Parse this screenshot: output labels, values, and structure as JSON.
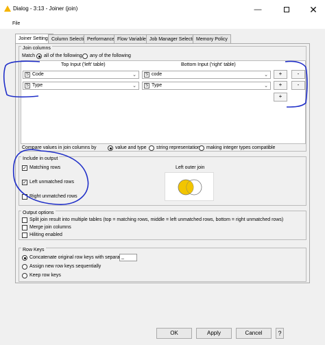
{
  "window": {
    "title": "Dialog - 3:13 - Joiner (join)",
    "minimize": "—",
    "close": "✕"
  },
  "menu": {
    "file": "File"
  },
  "tabs": [
    {
      "label": "Joiner Settings"
    },
    {
      "label": "Column Selection"
    },
    {
      "label": "Performance"
    },
    {
      "label": "Flow Variables"
    },
    {
      "label": "Job Manager Selection"
    },
    {
      "label": "Memory Policy"
    }
  ],
  "join_columns": {
    "group_title": "Join columns",
    "match_label": "Match",
    "match_all": "all of the following",
    "match_any": "any of the following",
    "top_header": "Top Input ('left' table)",
    "bottom_header": "Bottom Input ('right' table)",
    "rows": [
      {
        "type": "S",
        "left": "Code",
        "right": "code"
      },
      {
        "type": "S",
        "left": "Type",
        "right": "Type"
      }
    ],
    "add_label": "+",
    "remove_label": "-",
    "compare_label": "Compare values in join columns by",
    "compare_value_type": "value and type",
    "compare_string": "string representation",
    "compare_integer": "making integer types compatible"
  },
  "include_output": {
    "group_title": "Include in output",
    "matching_rows": "Matching rows",
    "left_unmatched": "Left unmatched rows",
    "right_unmatched": "Right unmatched rows",
    "join_type_label": "Left outer join",
    "venn_color": "#f2c500"
  },
  "output_options": {
    "group_title": "Output options",
    "split": "Split join result into multiple tables (top = matching rows, middle = left unmatched rows, bottom = right unmatched rows)",
    "merge": "Merge join columns",
    "hiliting": "Hiliting enabled"
  },
  "row_keys": {
    "group_title": "Row Keys",
    "concatenate": "Concatenate original row keys with separator",
    "separator": "_",
    "assign_new": "Assign new row keys sequentially",
    "keep": "Keep row keys"
  },
  "buttons": {
    "ok": "OK",
    "apply": "Apply",
    "cancel": "Cancel",
    "help": "?"
  },
  "annotation_color": "#1f2ec8"
}
